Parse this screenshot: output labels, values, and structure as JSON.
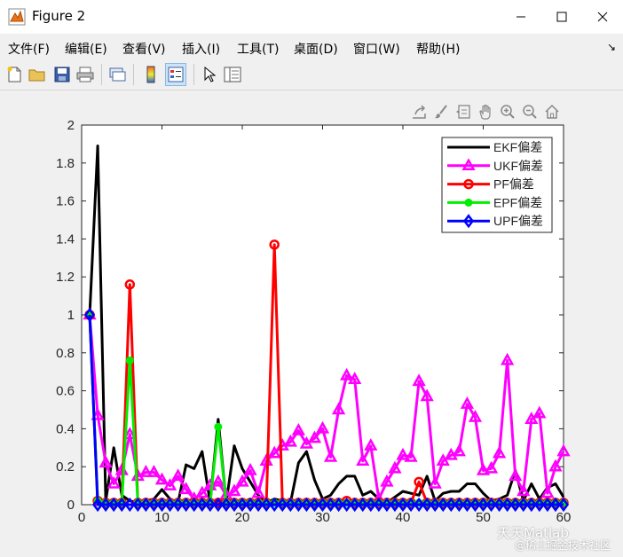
{
  "window": {
    "title": "Figure 2"
  },
  "menu": [
    "文件(F)",
    "编辑(E)",
    "查看(V)",
    "插入(I)",
    "工具(T)",
    "桌面(D)",
    "窗口(W)",
    "帮助(H)"
  ],
  "watermark": {
    "line1": "天天Matlab",
    "line2": "@稀土掘金技术社区"
  },
  "chart_data": {
    "type": "line",
    "xlim": [
      0,
      60
    ],
    "ylim": [
      0,
      2
    ],
    "xticks": [
      0,
      10,
      20,
      30,
      40,
      50,
      60
    ],
    "yticks": [
      0,
      0.2,
      0.4,
      0.6,
      0.8,
      1,
      1.2,
      1.4,
      1.6,
      1.8,
      2
    ],
    "xtick_labels": [
      "0",
      "10",
      "20",
      "30",
      "40",
      "50",
      "60"
    ],
    "ytick_labels": [
      "0",
      "0.2",
      "0.4",
      "0.6",
      "0.8",
      "1",
      "1.2",
      "1.4",
      "1.6",
      "1.8",
      "2"
    ],
    "grid": false,
    "legend": "top-right",
    "x": [
      1,
      2,
      3,
      4,
      5,
      6,
      7,
      8,
      9,
      10,
      11,
      12,
      13,
      14,
      15,
      16,
      17,
      18,
      19,
      20,
      21,
      22,
      23,
      24,
      25,
      26,
      27,
      28,
      29,
      30,
      31,
      32,
      33,
      34,
      35,
      36,
      37,
      38,
      39,
      40,
      41,
      42,
      43,
      44,
      45,
      46,
      47,
      48,
      49,
      50,
      51,
      52,
      53,
      54,
      55,
      56,
      57,
      58,
      59,
      60
    ],
    "series": [
      {
        "name": "EKF偏差",
        "color": "#000000",
        "marker": "none",
        "values": [
          1.0,
          1.89,
          0.02,
          0.3,
          0.05,
          0.02,
          0.01,
          0.02,
          0.03,
          0.08,
          0.03,
          0.01,
          0.21,
          0.19,
          0.28,
          0.01,
          0.45,
          0.01,
          0.31,
          0.19,
          0.12,
          0.05,
          0.01,
          0.03,
          0.02,
          0.01,
          0.22,
          0.28,
          0.13,
          0.03,
          0.05,
          0.11,
          0.15,
          0.15,
          0.05,
          0.07,
          0.03,
          0.01,
          0.04,
          0.07,
          0.06,
          0.05,
          0.15,
          0.02,
          0.06,
          0.07,
          0.07,
          0.11,
          0.11,
          0.06,
          0.02,
          0.03,
          0.05,
          0.18,
          0.02,
          0.11,
          0.03,
          0.09,
          0.11,
          0.04
        ]
      },
      {
        "name": "UKF偏差",
        "color": "#ff00ff",
        "marker": "triangle",
        "values": [
          1.0,
          0.47,
          0.22,
          0.11,
          0.18,
          0.37,
          0.15,
          0.17,
          0.17,
          0.13,
          0.1,
          0.15,
          0.08,
          0.03,
          0.06,
          0.1,
          0.12,
          0.05,
          0.07,
          0.12,
          0.18,
          0.06,
          0.23,
          0.27,
          0.31,
          0.33,
          0.39,
          0.32,
          0.35,
          0.4,
          0.25,
          0.5,
          0.68,
          0.66,
          0.23,
          0.31,
          0.03,
          0.12,
          0.19,
          0.26,
          0.25,
          0.65,
          0.57,
          0.11,
          0.23,
          0.26,
          0.28,
          0.53,
          0.46,
          0.18,
          0.19,
          0.27,
          0.76,
          0.15,
          0.07,
          0.45,
          0.48,
          0.06,
          0.2,
          0.28
        ]
      },
      {
        "name": "PF偏差",
        "color": "#ff0000",
        "marker": "circle",
        "values": [
          1.0,
          0.02,
          0.01,
          0.01,
          0.01,
          1.16,
          0.01,
          0.01,
          0.01,
          0.01,
          0.01,
          0.01,
          0.01,
          0.01,
          0.01,
          0.01,
          0.01,
          0.01,
          0.01,
          0.01,
          0.01,
          0.01,
          0.01,
          1.37,
          0.01,
          0.01,
          0.01,
          0.01,
          0.01,
          0.01,
          0.01,
          0.01,
          0.02,
          0.01,
          0.01,
          0.01,
          0.01,
          0.01,
          0.01,
          0.01,
          0.01,
          0.12,
          0.01,
          0.01,
          0.01,
          0.01,
          0.01,
          0.01,
          0.01,
          0.01,
          0.01,
          0.01,
          0.01,
          0.01,
          0.01,
          0.01,
          0.01,
          0.01,
          0.01,
          0.01
        ]
      },
      {
        "name": "EPF偏差",
        "color": "#00ee00",
        "marker": "dot",
        "values": [
          1.0,
          0.02,
          0.01,
          0.01,
          0.01,
          0.76,
          0.01,
          0.01,
          0.01,
          0.01,
          0.01,
          0.01,
          0.01,
          0.01,
          0.01,
          0.01,
          0.41,
          0.01,
          0.01,
          0.01,
          0.01,
          0.01,
          0.01,
          0.01,
          0.01,
          0.01,
          0.01,
          0.01,
          0.01,
          0.01,
          0.01,
          0.01,
          0.01,
          0.01,
          0.01,
          0.01,
          0.01,
          0.01,
          0.01,
          0.01,
          0.01,
          0.01,
          0.01,
          0.01,
          0.01,
          0.01,
          0.01,
          0.01,
          0.01,
          0.01,
          0.01,
          0.01,
          0.01,
          0.01,
          0.01,
          0.01,
          0.01,
          0.01,
          0.01,
          0.01
        ]
      },
      {
        "name": "UPF偏差",
        "color": "#0000ff",
        "marker": "diamond",
        "values": [
          1.0,
          0.0,
          0.0,
          0.0,
          0.0,
          0.0,
          0.0,
          0.0,
          0.0,
          0.0,
          0.0,
          0.0,
          0.0,
          0.0,
          0.0,
          0.0,
          0.0,
          0.0,
          0.0,
          0.0,
          0.0,
          0.0,
          0.0,
          0.0,
          0.0,
          0.0,
          0.0,
          0.0,
          0.0,
          0.0,
          0.0,
          0.0,
          0.0,
          0.0,
          0.0,
          0.0,
          0.0,
          0.0,
          0.0,
          0.0,
          0.0,
          0.0,
          0.0,
          0.0,
          0.0,
          0.0,
          0.0,
          0.0,
          0.0,
          0.0,
          0.0,
          0.0,
          0.0,
          0.0,
          0.0,
          0.0,
          0.0,
          0.0,
          0.0,
          0.0
        ]
      }
    ]
  }
}
